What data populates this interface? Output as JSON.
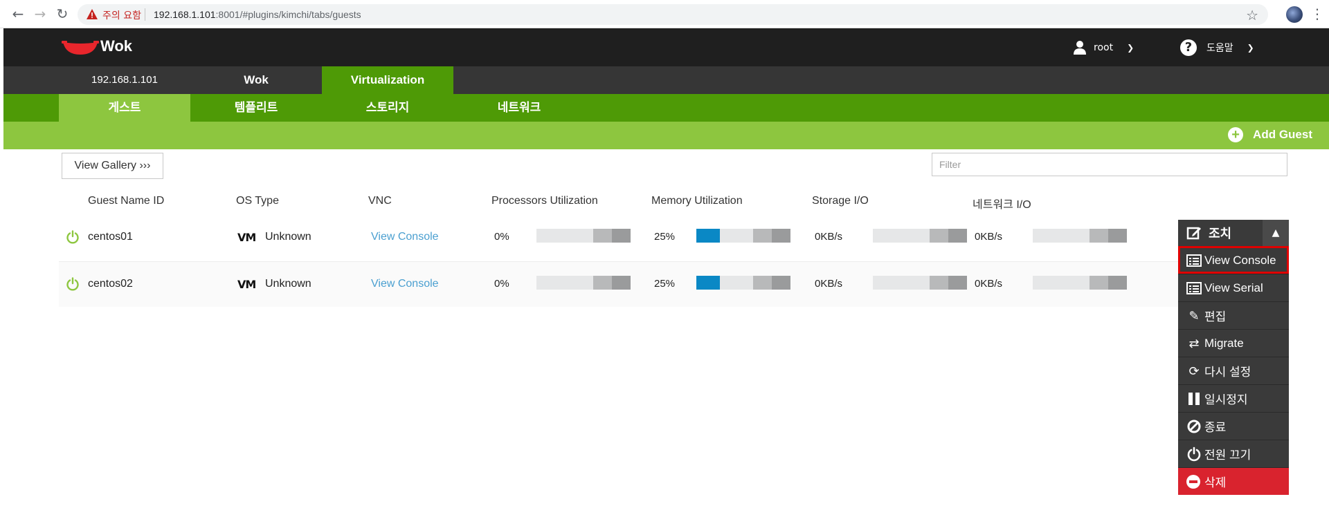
{
  "browser": {
    "warning": "주의 요함",
    "url_host": "192.168.1.101",
    "url_rest": ":8001/#plugins/kimchi/tabs/guests"
  },
  "header": {
    "app_title": "Wok",
    "user": "root",
    "help": "도움말"
  },
  "top_tabs": {
    "host": "192.168.1.101",
    "wok": "Wok",
    "virtualization": "Virtualization"
  },
  "sub_tabs": [
    "게스트",
    "템플리트",
    "스토리지",
    "네트워크"
  ],
  "toolbar": {
    "add_guest": "Add Guest",
    "view_gallery": "View Gallery ›››",
    "filter_placeholder": "Filter"
  },
  "table": {
    "headers": [
      "Guest Name ID",
      "OS Type",
      "VNC",
      "Processors Utilization",
      "Memory Utilization",
      "Storage I/O",
      "네트워크 I/O"
    ],
    "rows": [
      {
        "name": "centos01",
        "os_badge": "VM",
        "os": "Unknown",
        "vnc": "View Console",
        "cpu": "0%",
        "cpu_value": 0,
        "memory": "25%",
        "memory_value": 25,
        "storage": "0KB/s",
        "network": "0KB/s"
      },
      {
        "name": "centos02",
        "os_badge": "VM",
        "os": "Unknown",
        "vnc": "View Console",
        "cpu": "0%",
        "cpu_value": 0,
        "memory": "25%",
        "memory_value": 25,
        "storage": "0KB/s",
        "network": "0KB/s"
      }
    ]
  },
  "actions_menu": {
    "title": "조치",
    "items": [
      "View Console",
      "View Serial",
      "편집",
      "Migrate",
      "다시 설정",
      "일시정지",
      "종료",
      "전원 끄기",
      "삭제"
    ]
  },
  "colors": {
    "dark_header": "#1f1f1f",
    "tab_bar": "#363636",
    "green_dark": "#4e9a06",
    "green_light": "#8dc63f",
    "link_blue": "#4a9fd0",
    "memory_fill": "#0a88c5",
    "danger_red": "#d9232e"
  }
}
